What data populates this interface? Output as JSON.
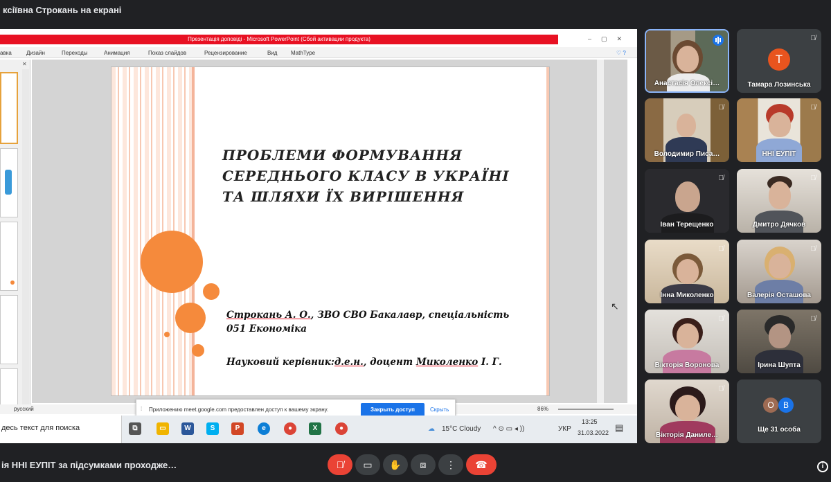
{
  "header": {
    "presenter_banner": "ксіївна Строкань на екрані"
  },
  "powerpoint": {
    "window_title": "Презентація доповіді  -  Microsoft PowerPoint (Сбой активации продукта)",
    "ribbon_tabs": [
      "авка",
      "Дизайн",
      "Переходы",
      "Анимация",
      "Показ слайдов",
      "Рецензирование",
      "Вид",
      "MathType"
    ],
    "status_language": "русский",
    "zoom": "86%"
  },
  "slide": {
    "title_lines": [
      "ПРОБЛЕМИ ФОРМУВАННЯ",
      "СЕРЕДНЬОГО КЛАСУ В УКРАЇНІ",
      "ТА ШЛЯХИ ЇХ ВИРІШЕННЯ"
    ],
    "author_name": "Строкань А. О.",
    "author_rest": ", ЗВО СВО Бакалавр, спеціальність",
    "author_line2": "051 Економіка",
    "supervisor_prefix": "Науковий керівник:",
    "supervisor_degree": "д.е.н.",
    "supervisor_mid": ", доцент ",
    "supervisor_name": "Миколенко",
    "supervisor_initials": " І. Г."
  },
  "share_notice": {
    "message": "Приложению meet.google.com предоставлен доступ к вашему экрану.",
    "stop_label": "Закрыть доступ",
    "hide_label": "Скрыть"
  },
  "taskbar": {
    "search_placeholder": "десь текст для поиска",
    "weather": "15°C  Cloudy",
    "lang": "УКР",
    "time": "13:25",
    "date": "31.03.2022"
  },
  "participants": [
    {
      "name": "Анастасія Олексі…",
      "speaking": true
    },
    {
      "name": "Тамара Лозинська",
      "avatar_letter": "T",
      "muted": true
    },
    {
      "name": "Володимир Писа…",
      "muted": true
    },
    {
      "name": "ННІ ЕУПІТ",
      "muted": true
    },
    {
      "name": "Іван Терещенко",
      "muted": true
    },
    {
      "name": "Дмитро Дячков",
      "muted": true
    },
    {
      "name": "Інна Миколенко",
      "muted": true
    },
    {
      "name": "Валерія Осташова",
      "muted": true
    },
    {
      "name": "Вікторія Воронова",
      "muted": true
    },
    {
      "name": "Ірина Шупта",
      "muted": true
    },
    {
      "name": "Вікторія Даниле…",
      "muted": true
    },
    {
      "name": "Ще 31 особа",
      "avatar_letters": [
        "O",
        "B"
      ]
    }
  ],
  "footer": {
    "meeting_title": "ія ННІ ЕУПІТ за підсумками проходже…"
  },
  "colors": {
    "accent_orange": "#f58a3c",
    "meet_bg": "#202124",
    "tile_bg": "#3c4043",
    "red": "#ea4335",
    "blue": "#1a73e8"
  }
}
